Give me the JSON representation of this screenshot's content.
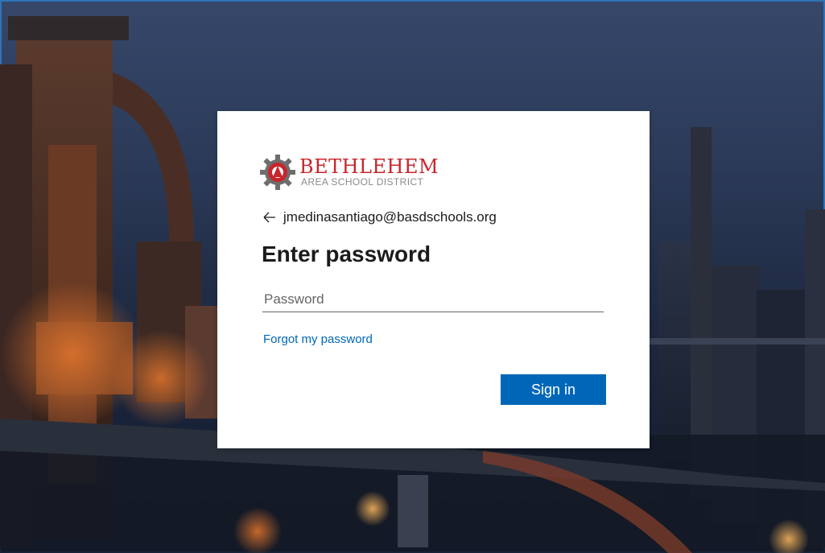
{
  "background": {
    "description_icon": "steel-mill-night-photo",
    "accent_border": "#2d74b8"
  },
  "logo": {
    "title": "BETHLEHEM",
    "subtitle": "AREA SCHOOL DISTRICT",
    "brand_color": "#c8262c",
    "icon": "gear-emblem-icon"
  },
  "identity": {
    "back_icon": "back-arrow-icon",
    "email": "jmedinasantiago@basdschools.org"
  },
  "form": {
    "title": "Enter password",
    "password_placeholder": "Password",
    "password_value": "",
    "forgot_link": "Forgot my password",
    "submit_label": "Sign in",
    "accent_color": "#0067b8"
  }
}
